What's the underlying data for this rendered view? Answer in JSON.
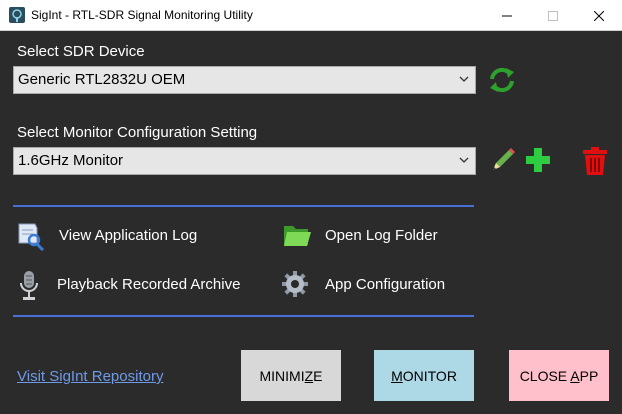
{
  "window": {
    "title": "SigInt - RTL-SDR Signal Monitoring Utility"
  },
  "device": {
    "label": "Select SDR Device",
    "selected": "Generic RTL2832U OEM"
  },
  "config": {
    "label": "Select Monitor Configuration Setting",
    "selected": "1.6GHz Monitor"
  },
  "actions": {
    "view_log": "View Application Log",
    "open_folder": "Open Log Folder",
    "playback": "Playback Recorded Archive",
    "app_config": "App Configuration"
  },
  "footer": {
    "repo_link": "Visit SigInt Repository",
    "minimize": {
      "before": "MINIMI",
      "mnemonic": "Z",
      "after": "E"
    },
    "monitor": {
      "before": "",
      "mnemonic": "M",
      "after": "ONITOR"
    },
    "close": {
      "before": "CLOSE ",
      "mnemonic": "A",
      "after": "PP"
    }
  },
  "colors": {
    "background": "#2b2b2b",
    "separator": "#4a6fd6",
    "link": "#6f9ae8",
    "minimize_button": "#d8d8d8",
    "monitor_button": "#add8e6",
    "close_button": "#ffc0cb",
    "refresh_icon": "#2ea02e",
    "add_icon": "#2ecc40",
    "delete_icon": "#e01010"
  }
}
